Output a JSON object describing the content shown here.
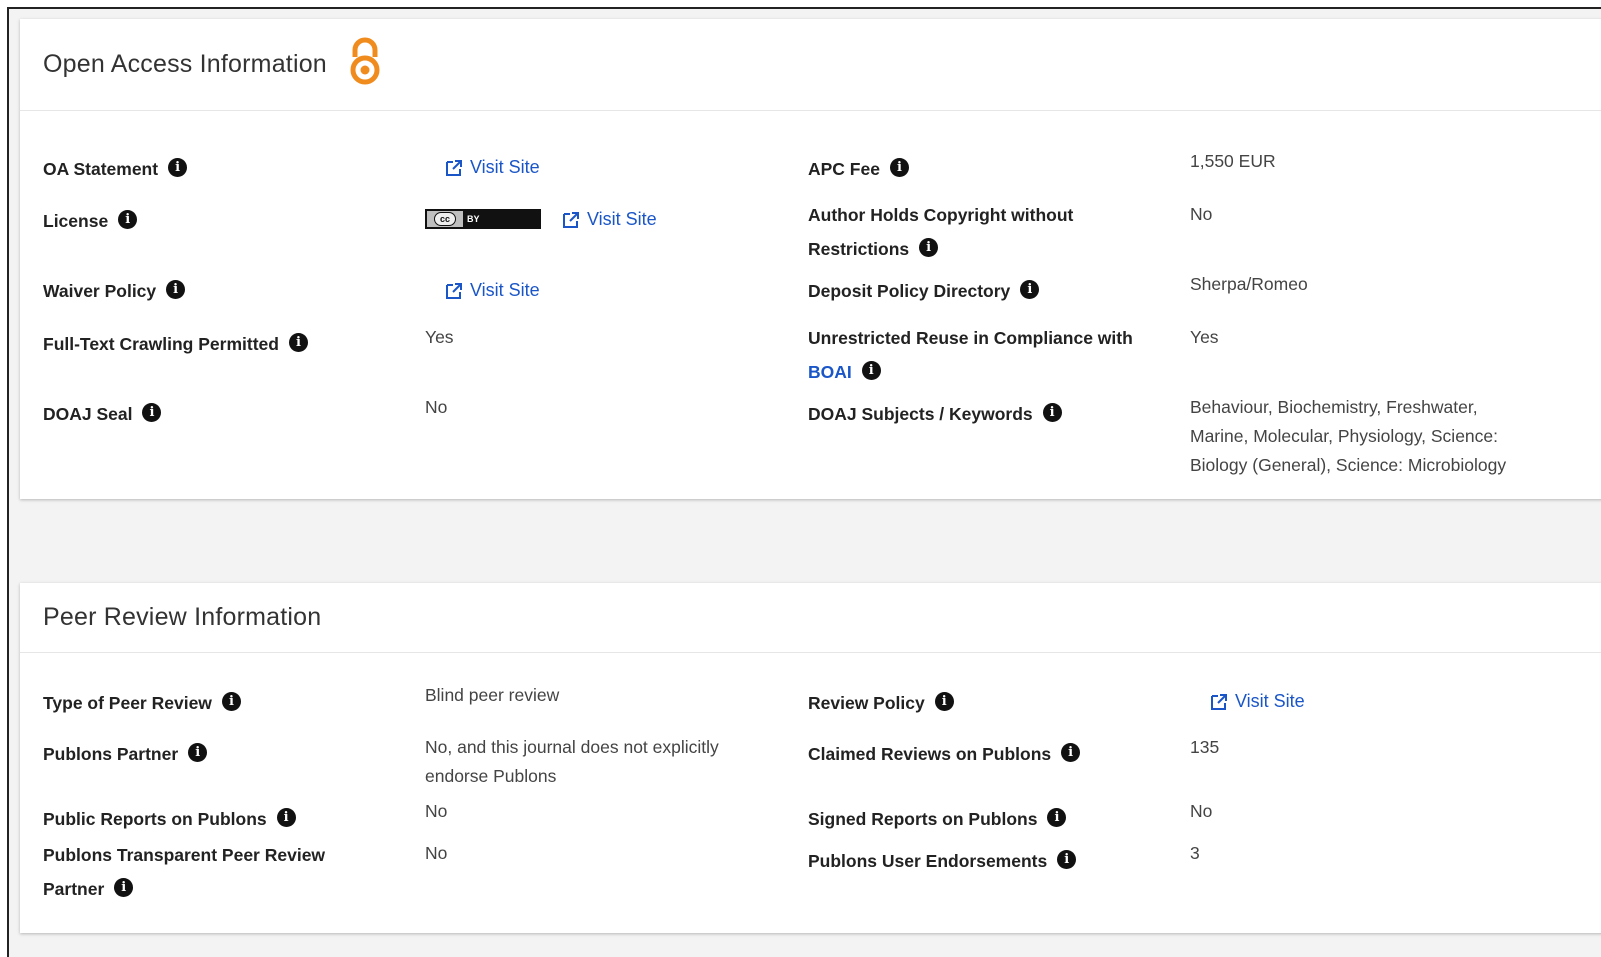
{
  "open_access": {
    "title": "Open Access Information",
    "logo_icon": "open-access-icon",
    "logo_color": "#f08c1e",
    "oa_statement": {
      "label": "OA Statement",
      "link": "Visit Site"
    },
    "license": {
      "label": "License",
      "badge_cc": "cc",
      "badge_by": "BY",
      "link": "Visit Site"
    },
    "waiver_policy": {
      "label": "Waiver Policy",
      "link": "Visit Site"
    },
    "full_text_crawling": {
      "label": "Full-Text Crawling Permitted",
      "value": "Yes"
    },
    "doaj_seal": {
      "label": "DOAJ Seal",
      "value": "No"
    },
    "apc_fee": {
      "label": "APC Fee",
      "value": "1,550 EUR"
    },
    "author_copyright": {
      "label_line1": "Author Holds Copyright without",
      "label_line2": "Restrictions",
      "value": "No"
    },
    "deposit_policy": {
      "label": "Deposit Policy Directory",
      "value": "Sherpa/Romeo"
    },
    "unrestricted_reuse": {
      "label_line1": "Unrestricted Reuse in Compliance with",
      "label_link": "BOAI",
      "value": "Yes"
    },
    "doaj_subjects": {
      "label": "DOAJ Subjects / Keywords",
      "value_line1": "Behaviour, Biochemistry, Freshwater,",
      "value_line2": "Marine, Molecular, Physiology, Science:",
      "value_line3": "Biology (General), Science: Microbiology"
    }
  },
  "peer_review": {
    "title": "Peer Review Information",
    "type_of_peer_review": {
      "label": "Type of Peer Review",
      "value": "Blind peer review"
    },
    "publons_partner": {
      "label": "Publons Partner",
      "value_line1": "No, and this journal does not explicitly",
      "value_line2": "endorse Publons"
    },
    "public_reports": {
      "label": "Public Reports on Publons",
      "value": "No"
    },
    "transparent_partner": {
      "label_line1": "Publons Transparent Peer Review",
      "label_line2": "Partner",
      "value": "No"
    },
    "review_policy": {
      "label": "Review Policy",
      "link": "Visit Site"
    },
    "claimed_reviews": {
      "label": "Claimed Reviews on Publons",
      "value": "135"
    },
    "signed_reports": {
      "label": "Signed Reports on Publons",
      "value": "No"
    },
    "user_endorsements": {
      "label": "Publons User Endorsements",
      "value": "3"
    }
  },
  "colors": {
    "link": "#1a56c8",
    "label": "#222222",
    "value": "#444444"
  }
}
